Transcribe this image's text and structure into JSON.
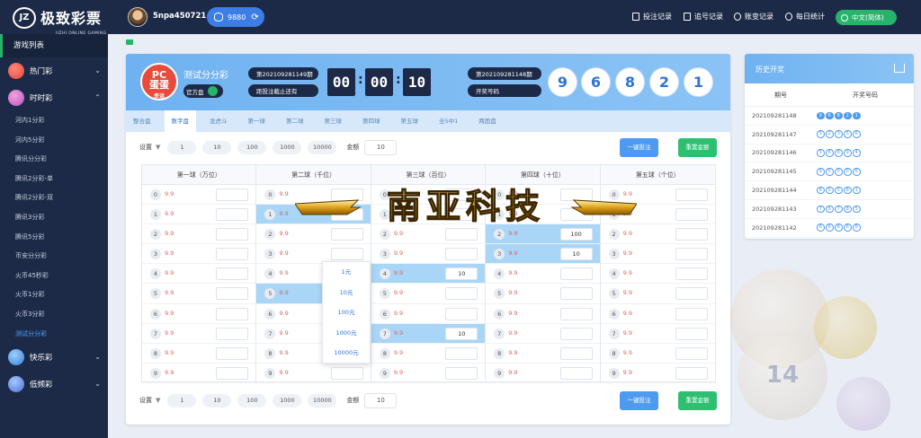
{
  "header": {
    "logo_text": "极致彩票",
    "logo_sub": "JIZHI ONLINE GAMING",
    "logo_badge": "JZ",
    "username": "5npa450721 !",
    "balance": "9880",
    "links": [
      "投注记录",
      "追号记录",
      "账变记录",
      "每日统计"
    ],
    "language": "中文(简体)"
  },
  "sidebar": {
    "title": "游戏列表",
    "categories": [
      {
        "label": "热门彩",
        "expanded": false
      },
      {
        "label": "时时彩",
        "expanded": true
      },
      {
        "label": "快乐彩",
        "expanded": false
      },
      {
        "label": "低频彩",
        "expanded": false
      }
    ],
    "subitems": [
      "河内1分彩",
      "河内5分彩",
      "腾讯分分彩",
      "腾讯2分彩-单",
      "腾讯2分彩-双",
      "腾讯3分彩",
      "腾讯5分彩",
      "币安分分彩",
      "火币45秒彩",
      "火币1分彩",
      "火币3分彩",
      "测试分分彩"
    ],
    "active_subitem": "测试分分彩"
  },
  "lottery": {
    "logo_top": "PC",
    "logo_mid": "蛋蛋",
    "logo_sub": "幸运",
    "name": "测试分分彩",
    "official_label": "官方盘",
    "current_issue": "第202109281149期",
    "countdown_label": "距投注截止还有",
    "countdown": [
      "00",
      "00",
      "10"
    ],
    "last_issue": "第202109281148期",
    "draw_label": "开奖号码",
    "draw_numbers": [
      "9",
      "6",
      "8",
      "2",
      "1"
    ]
  },
  "tabs": [
    "整合盘",
    "数字盘",
    "龙虎斗",
    "第一球",
    "第二球",
    "第三球",
    "第四球",
    "第五球",
    "全5中1",
    "两面盘"
  ],
  "active_tab": "数字盘",
  "settings": {
    "label": "设置",
    "chips": [
      "1",
      "10",
      "100",
      "1000",
      "10000"
    ],
    "amount_label": "金额",
    "amount_value": "10",
    "quick_bet": "一键投注",
    "reset": "重置金额"
  },
  "columns": [
    {
      "title": "第一球（万位）",
      "cells": [
        {
          "n": "0",
          "odd": "9.9",
          "val": "",
          "hl": false
        },
        {
          "n": "1",
          "odd": "9.9",
          "val": "",
          "hl": false
        },
        {
          "n": "2",
          "odd": "9.9",
          "val": "",
          "hl": false
        },
        {
          "n": "3",
          "odd": "9.9",
          "val": "",
          "hl": false
        },
        {
          "n": "4",
          "odd": "9.9",
          "val": "",
          "hl": false
        },
        {
          "n": "5",
          "odd": "9.9",
          "val": "",
          "hl": false
        },
        {
          "n": "6",
          "odd": "9.9",
          "val": "",
          "hl": false
        },
        {
          "n": "7",
          "odd": "9.9",
          "val": "",
          "hl": false
        },
        {
          "n": "8",
          "odd": "9.9",
          "val": "",
          "hl": false
        },
        {
          "n": "9",
          "odd": "9.9",
          "val": "",
          "hl": false
        }
      ]
    },
    {
      "title": "第二球（千位）",
      "cells": [
        {
          "n": "0",
          "odd": "9.9",
          "val": "",
          "hl": false
        },
        {
          "n": "1",
          "odd": "9.9",
          "val": "",
          "hl": true
        },
        {
          "n": "2",
          "odd": "9.9",
          "val": "",
          "hl": false
        },
        {
          "n": "3",
          "odd": "9.9",
          "val": "",
          "hl": false
        },
        {
          "n": "4",
          "odd": "9.9",
          "val": "",
          "hl": false
        },
        {
          "n": "5",
          "odd": "9.9",
          "val": "",
          "hl": true
        },
        {
          "n": "6",
          "odd": "9.9",
          "val": "",
          "hl": false
        },
        {
          "n": "7",
          "odd": "9.9",
          "val": "",
          "hl": false
        },
        {
          "n": "8",
          "odd": "9.9",
          "val": "",
          "hl": false
        },
        {
          "n": "9",
          "odd": "9.9",
          "val": "",
          "hl": false
        }
      ]
    },
    {
      "title": "第三球（百位）",
      "cells": [
        {
          "n": "0",
          "odd": "9.9",
          "val": "",
          "hl": false
        },
        {
          "n": "1",
          "odd": "9.9",
          "val": "",
          "hl": false
        },
        {
          "n": "2",
          "odd": "9.9",
          "val": "",
          "hl": false
        },
        {
          "n": "3",
          "odd": "9.9",
          "val": "",
          "hl": false
        },
        {
          "n": "4",
          "odd": "9.9",
          "val": "10",
          "hl": true
        },
        {
          "n": "5",
          "odd": "9.9",
          "val": "",
          "hl": false
        },
        {
          "n": "6",
          "odd": "9.9",
          "val": "",
          "hl": false
        },
        {
          "n": "7",
          "odd": "9.9",
          "val": "10",
          "hl": true
        },
        {
          "n": "8",
          "odd": "9.9",
          "val": "",
          "hl": false
        },
        {
          "n": "9",
          "odd": "9.9",
          "val": "",
          "hl": false
        }
      ]
    },
    {
      "title": "第四球（十位）",
      "cells": [
        {
          "n": "0",
          "odd": "9.9",
          "val": "",
          "hl": false
        },
        {
          "n": "1",
          "odd": "9.9",
          "val": "",
          "hl": false
        },
        {
          "n": "2",
          "odd": "9.9",
          "val": "100",
          "hl": true
        },
        {
          "n": "3",
          "odd": "9.9",
          "val": "10",
          "hl": true
        },
        {
          "n": "4",
          "odd": "9.9",
          "val": "",
          "hl": false
        },
        {
          "n": "5",
          "odd": "9.9",
          "val": "",
          "hl": false
        },
        {
          "n": "6",
          "odd": "9.9",
          "val": "",
          "hl": false
        },
        {
          "n": "7",
          "odd": "9.9",
          "val": "",
          "hl": false
        },
        {
          "n": "8",
          "odd": "9.9",
          "val": "",
          "hl": false
        },
        {
          "n": "9",
          "odd": "9.9",
          "val": "",
          "hl": false
        }
      ]
    },
    {
      "title": "第五球（个位）",
      "cells": [
        {
          "n": "0",
          "odd": "9.9",
          "val": "",
          "hl": false
        },
        {
          "n": "1",
          "odd": "9.9",
          "val": "",
          "hl": false
        },
        {
          "n": "2",
          "odd": "9.9",
          "val": "",
          "hl": false
        },
        {
          "n": "3",
          "odd": "9.9",
          "val": "",
          "hl": false
        },
        {
          "n": "4",
          "odd": "9.9",
          "val": "",
          "hl": false
        },
        {
          "n": "5",
          "odd": "9.9",
          "val": "",
          "hl": false
        },
        {
          "n": "6",
          "odd": "9.9",
          "val": "",
          "hl": false
        },
        {
          "n": "7",
          "odd": "9.9",
          "val": "",
          "hl": false
        },
        {
          "n": "8",
          "odd": "9.9",
          "val": "",
          "hl": false
        },
        {
          "n": "9",
          "odd": "9.9",
          "val": "",
          "hl": false
        }
      ]
    }
  ],
  "amount_popup": [
    "1元",
    "10元",
    "100元",
    "1000元",
    "10000元"
  ],
  "watermark": "南亚科技",
  "history": {
    "title": "历史开奖",
    "col_issue": "期号",
    "col_numbers": "开奖号码",
    "rows": [
      {
        "issue": "202109281148",
        "nums": [
          "9",
          "6",
          "8",
          "2",
          "1"
        ],
        "filled": true
      },
      {
        "issue": "202109281147",
        "nums": [
          "5",
          "2",
          "3",
          "5",
          "6"
        ],
        "filled": false
      },
      {
        "issue": "202109281146",
        "nums": [
          "5",
          "6",
          "8",
          "9",
          "4"
        ],
        "filled": false
      },
      {
        "issue": "202109281145",
        "nums": [
          "9",
          "5",
          "0",
          "0",
          "6"
        ],
        "filled": false
      },
      {
        "issue": "202109281144",
        "nums": [
          "8",
          "5",
          "5",
          "8",
          "1"
        ],
        "filled": false
      },
      {
        "issue": "202109281143",
        "nums": [
          "7",
          "5",
          "7",
          "8",
          "5"
        ],
        "filled": false
      },
      {
        "issue": "202109281142",
        "nums": [
          "8",
          "6",
          "8",
          "8",
          "8"
        ],
        "filled": false
      }
    ]
  },
  "colors": {
    "nav": "#1d2a47",
    "accent": "#4e9af1",
    "green": "#2fbf71",
    "odds": "#e06666",
    "highlight": "#a9d5f7"
  },
  "bg_ball_number": "14"
}
